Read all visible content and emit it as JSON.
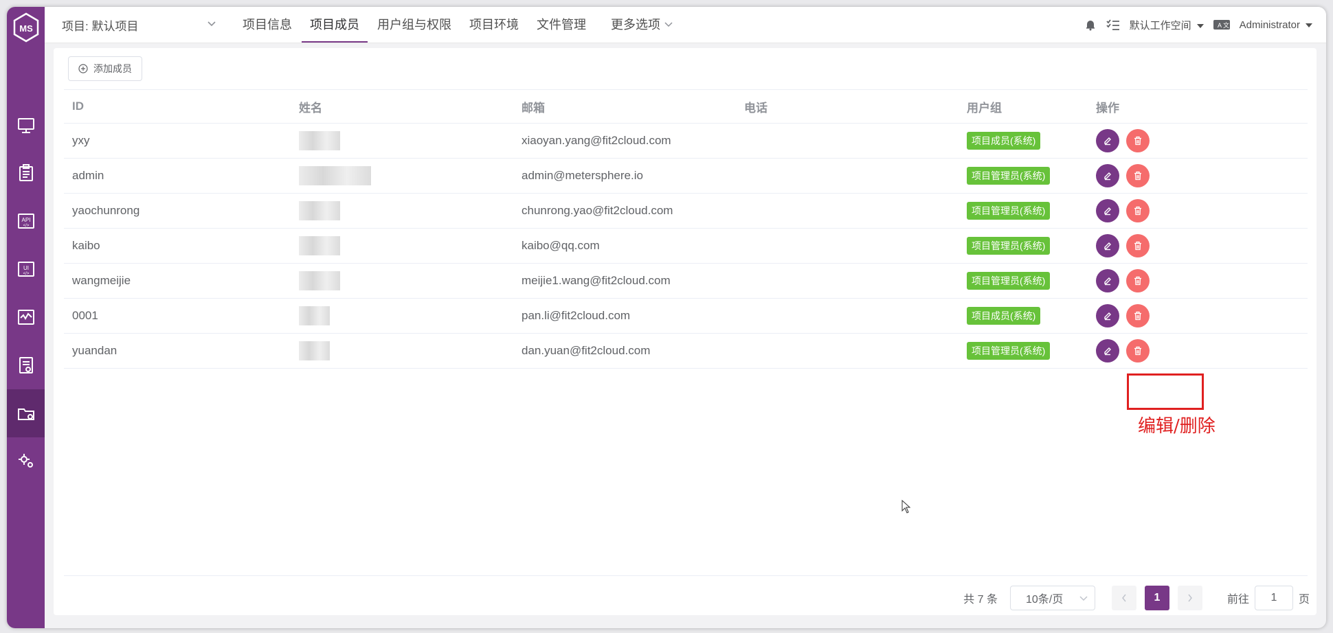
{
  "header": {
    "project_label": "项目: 默认项目",
    "menu": [
      "项目信息",
      "项目成员",
      "用户组与权限",
      "项目环境",
      "文件管理"
    ],
    "more_label": "更多选项",
    "workspace": "默认工作空间",
    "user": "Administrator"
  },
  "sidebar": {
    "logo_text": "MS",
    "icons": [
      "monitor-icon",
      "clipboard-icon",
      "api-icon",
      "ui-icon",
      "performance-icon",
      "report-icon",
      "project-folder-icon",
      "settings-icon"
    ],
    "active_index": 6
  },
  "toolbar": {
    "add_member_label": "添加成员"
  },
  "table": {
    "columns": [
      "ID",
      "姓名",
      "邮箱",
      "电话",
      "用户组",
      "操作"
    ],
    "rows": [
      {
        "id": "yxy",
        "email": "xiaoyan.yang@fit2cloud.com",
        "phone": "",
        "group": "项目成员(系统)"
      },
      {
        "id": "admin",
        "email": "admin@metersphere.io",
        "phone": "",
        "group": "项目管理员(系统)"
      },
      {
        "id": "yaochunrong",
        "email": "chunrong.yao@fit2cloud.com",
        "phone": "",
        "group": "项目管理员(系统)"
      },
      {
        "id": "kaibo",
        "email": "kaibo@qq.com",
        "phone": "",
        "group": "项目管理员(系统)"
      },
      {
        "id": "wangmeijie",
        "email": "meijie1.wang@fit2cloud.com",
        "phone": "",
        "group": "项目管理员(系统)"
      },
      {
        "id": "0001",
        "email": "pan.li@fit2cloud.com",
        "phone": "",
        "group": "项目成员(系统)"
      },
      {
        "id": "yuandan",
        "email": "dan.yuan@fit2cloud.com",
        "phone": "",
        "group": "项目管理员(系统)"
      }
    ]
  },
  "annotation": {
    "text": "编辑/删除"
  },
  "pagination": {
    "total_label": "共 7 条",
    "page_size": "10条/页",
    "current_page": "1",
    "goto_label": "前往",
    "goto_value": "1",
    "page_suffix": "页"
  },
  "colors": {
    "brand": "#783887",
    "success": "#67c23a",
    "danger": "#f56c6c",
    "annotation": "#e02020"
  }
}
